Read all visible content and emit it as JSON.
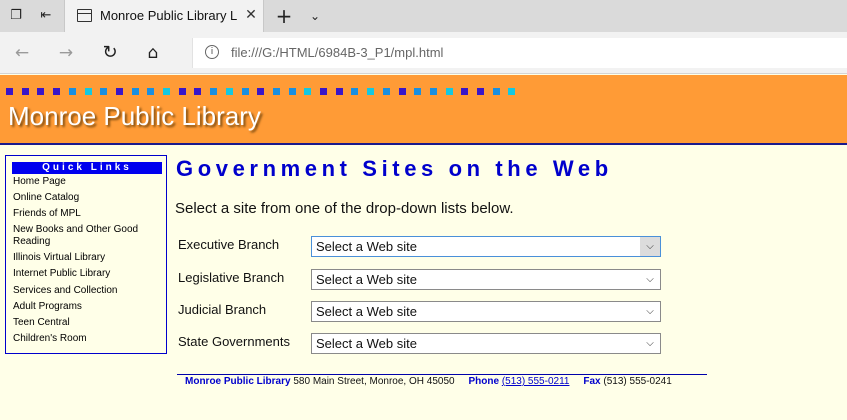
{
  "browser": {
    "tab_title": "Monroe Public Library L",
    "address_url": "file:///G:/HTML/6984B-3_P1/mpl.html"
  },
  "banner": {
    "title": "Monroe Public Library",
    "colors": {
      "background": "#ff9b36",
      "dot_colors": [
        "#3a16c8",
        "#1a8fe0",
        "#14c8e0"
      ]
    }
  },
  "quick_links": {
    "heading": "Quick Links",
    "items": [
      "Home Page",
      "Online Catalog",
      "Friends of MPL",
      "New Books and Other Good Reading",
      "Illinois Virtual Library",
      "Internet Public Library",
      "Services and Collection",
      "Adult Programs",
      "Teen Central",
      "Children's Room"
    ]
  },
  "main": {
    "heading": "Government Sites on the Web",
    "intro": "Select a site from one of the drop-down lists below.",
    "rows": [
      {
        "label": "Executive Branch",
        "selected": "Select a Web site"
      },
      {
        "label": "Legislative Branch",
        "selected": "Select a Web site"
      },
      {
        "label": "Judicial Branch",
        "selected": "Select a Web site"
      },
      {
        "label": "State Governments",
        "selected": "Select a Web site"
      }
    ]
  },
  "footer": {
    "name": "Monroe Public Library",
    "address": "580 Main Street, Monroe, OH  45050",
    "phone_label": "Phone",
    "phone": "(513) 555-0211",
    "fax_label": "Fax",
    "fax": "(513) 555-0241"
  }
}
